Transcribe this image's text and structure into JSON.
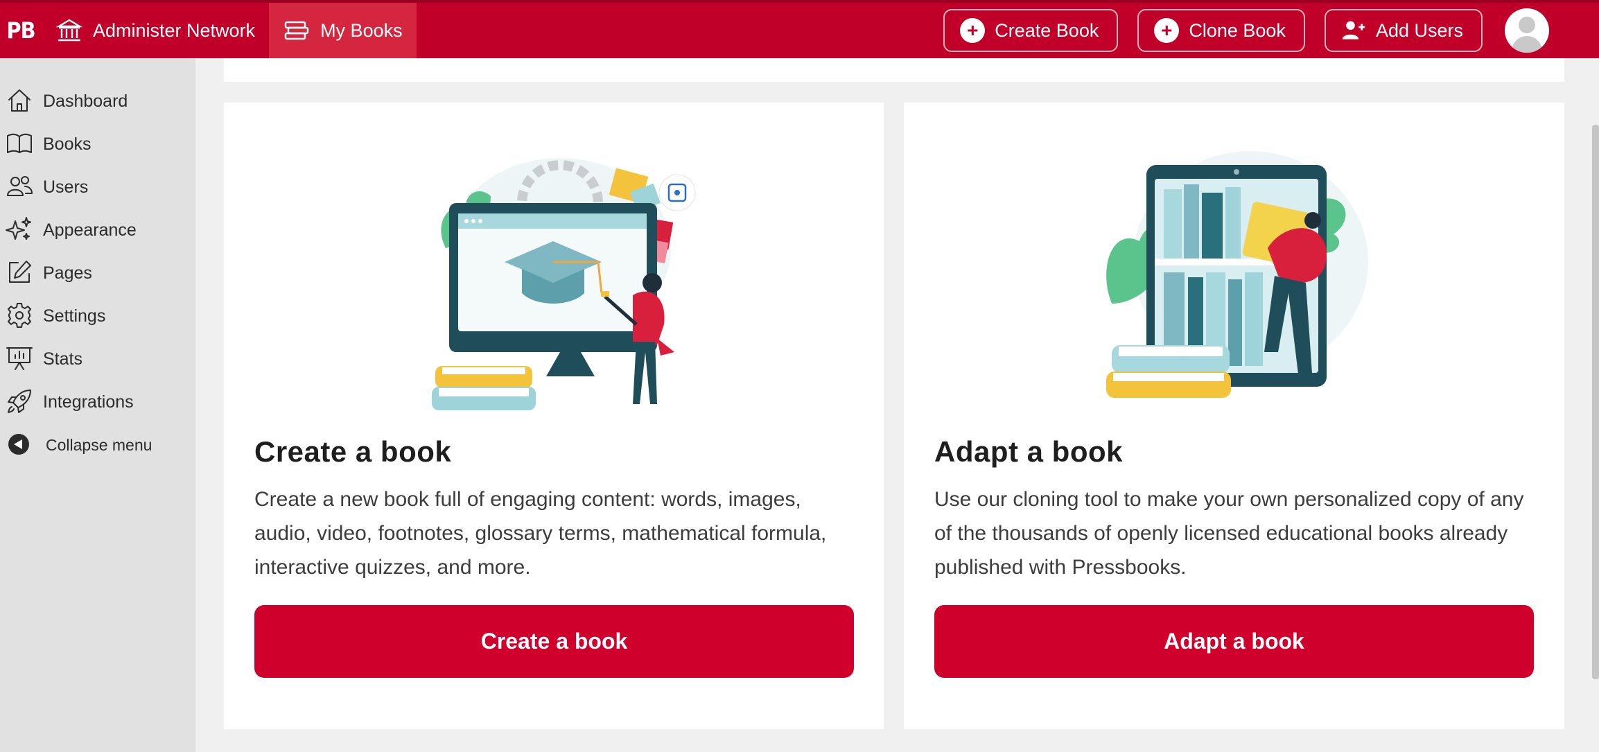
{
  "topbar": {
    "logo": "PB",
    "nav": [
      {
        "label": "Administer Network"
      },
      {
        "label": "My Books"
      }
    ],
    "actions": [
      {
        "label": "Create Book"
      },
      {
        "label": "Clone Book"
      },
      {
        "label": "Add Users"
      }
    ]
  },
  "sidebar": {
    "items": [
      {
        "label": "Dashboard",
        "icon": "home-icon"
      },
      {
        "label": "Books",
        "icon": "book-open-icon"
      },
      {
        "label": "Users",
        "icon": "users-icon"
      },
      {
        "label": "Appearance",
        "icon": "sparkles-icon"
      },
      {
        "label": "Pages",
        "icon": "pencil-square-icon"
      },
      {
        "label": "Settings",
        "icon": "gear-icon"
      },
      {
        "label": "Stats",
        "icon": "presentation-chart-icon"
      },
      {
        "label": "Integrations",
        "icon": "rocket-icon"
      }
    ],
    "collapse_label": "Collapse menu"
  },
  "cards": {
    "create": {
      "title": "Create a book",
      "text": "Create a new book full of engaging content: words, images, audio, video, footnotes, glossary terms, mathematical formula, interactive quizzes, and more.",
      "button": "Create a book"
    },
    "adapt": {
      "title": "Adapt a book",
      "text": "Use our cloning tool to make your own personalized copy of any of the thousands of openly licensed educational books already published with Pressbooks.",
      "button": "Adapt a book"
    }
  },
  "colors": {
    "brand": "#c1002a",
    "button": "#d0002c",
    "sidebar": "#e1e1e1"
  }
}
